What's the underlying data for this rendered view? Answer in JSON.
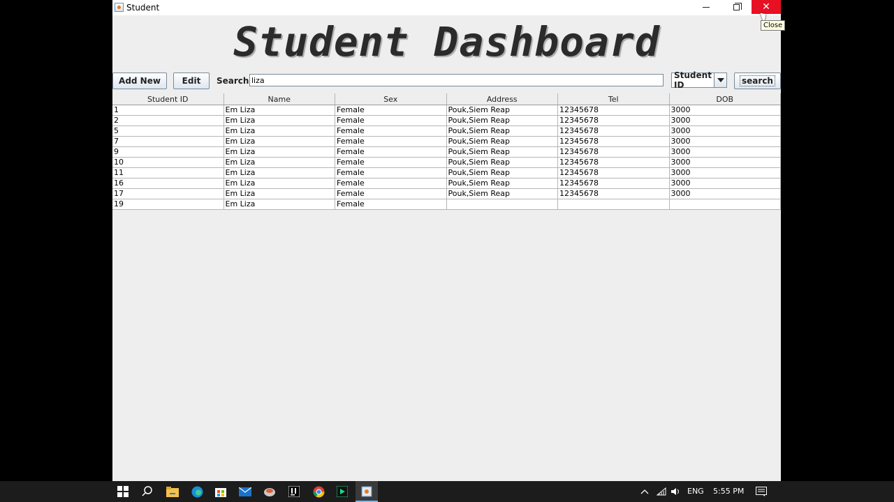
{
  "window": {
    "title": "Student",
    "tooltip": "Close"
  },
  "dashboard": {
    "title": "Student Dashboard"
  },
  "toolbar": {
    "add_label": "Add New",
    "edit_label": "Edit",
    "search_label": "Search",
    "search_value": "liza",
    "filter_selected": "Student ID",
    "search_button": "search"
  },
  "table": {
    "columns": [
      "Student ID",
      "Name",
      "Sex",
      "Address",
      "Tel",
      "DOB"
    ],
    "rows": [
      [
        "1",
        "Em Liza",
        "Female",
        "Pouk,Siem Reap",
        "12345678",
        "3000"
      ],
      [
        "2",
        "Em Liza",
        "Female",
        "Pouk,Siem Reap",
        "12345678",
        "3000"
      ],
      [
        "5",
        "Em Liza",
        "Female",
        "Pouk,Siem Reap",
        "12345678",
        "3000"
      ],
      [
        "7",
        "Em Liza",
        "Female",
        "Pouk,Siem Reap",
        "12345678",
        "3000"
      ],
      [
        "9",
        "Em Liza",
        "Female",
        "Pouk,Siem Reap",
        "12345678",
        "3000"
      ],
      [
        "10",
        "Em Liza",
        "Female",
        "Pouk,Siem Reap",
        "12345678",
        "3000"
      ],
      [
        "11",
        "Em Liza",
        "Female",
        "Pouk,Siem Reap",
        "12345678",
        "3000"
      ],
      [
        "16",
        "Em Liza",
        "Female",
        "Pouk,Siem Reap",
        "12345678",
        "3000"
      ],
      [
        "17",
        "Em Liza",
        "Female",
        "Pouk,Siem Reap",
        "12345678",
        "3000"
      ],
      [
        "19",
        "Em Liza",
        "Female",
        "",
        "",
        ""
      ]
    ]
  },
  "taskbar": {
    "language": "ENG",
    "time": "5:55 PM"
  },
  "icons": [
    "window-app-icon",
    "minimize-icon",
    "maximize-icon",
    "close-icon",
    "dropdown-arrow-icon",
    "start-icon",
    "search-icon",
    "file-explorer-icon",
    "edge-icon",
    "store-icon",
    "mail-icon",
    "app-icon",
    "intellij-icon",
    "chrome-icon",
    "pycharm-icon",
    "java-icon",
    "tray-chevron-icon",
    "wifi-icon",
    "volume-icon",
    "notifications-icon"
  ],
  "colors": {
    "close_hover": "#e81123",
    "window_bg": "#eeeeee",
    "taskbar_bg": "#1c1c1c"
  }
}
